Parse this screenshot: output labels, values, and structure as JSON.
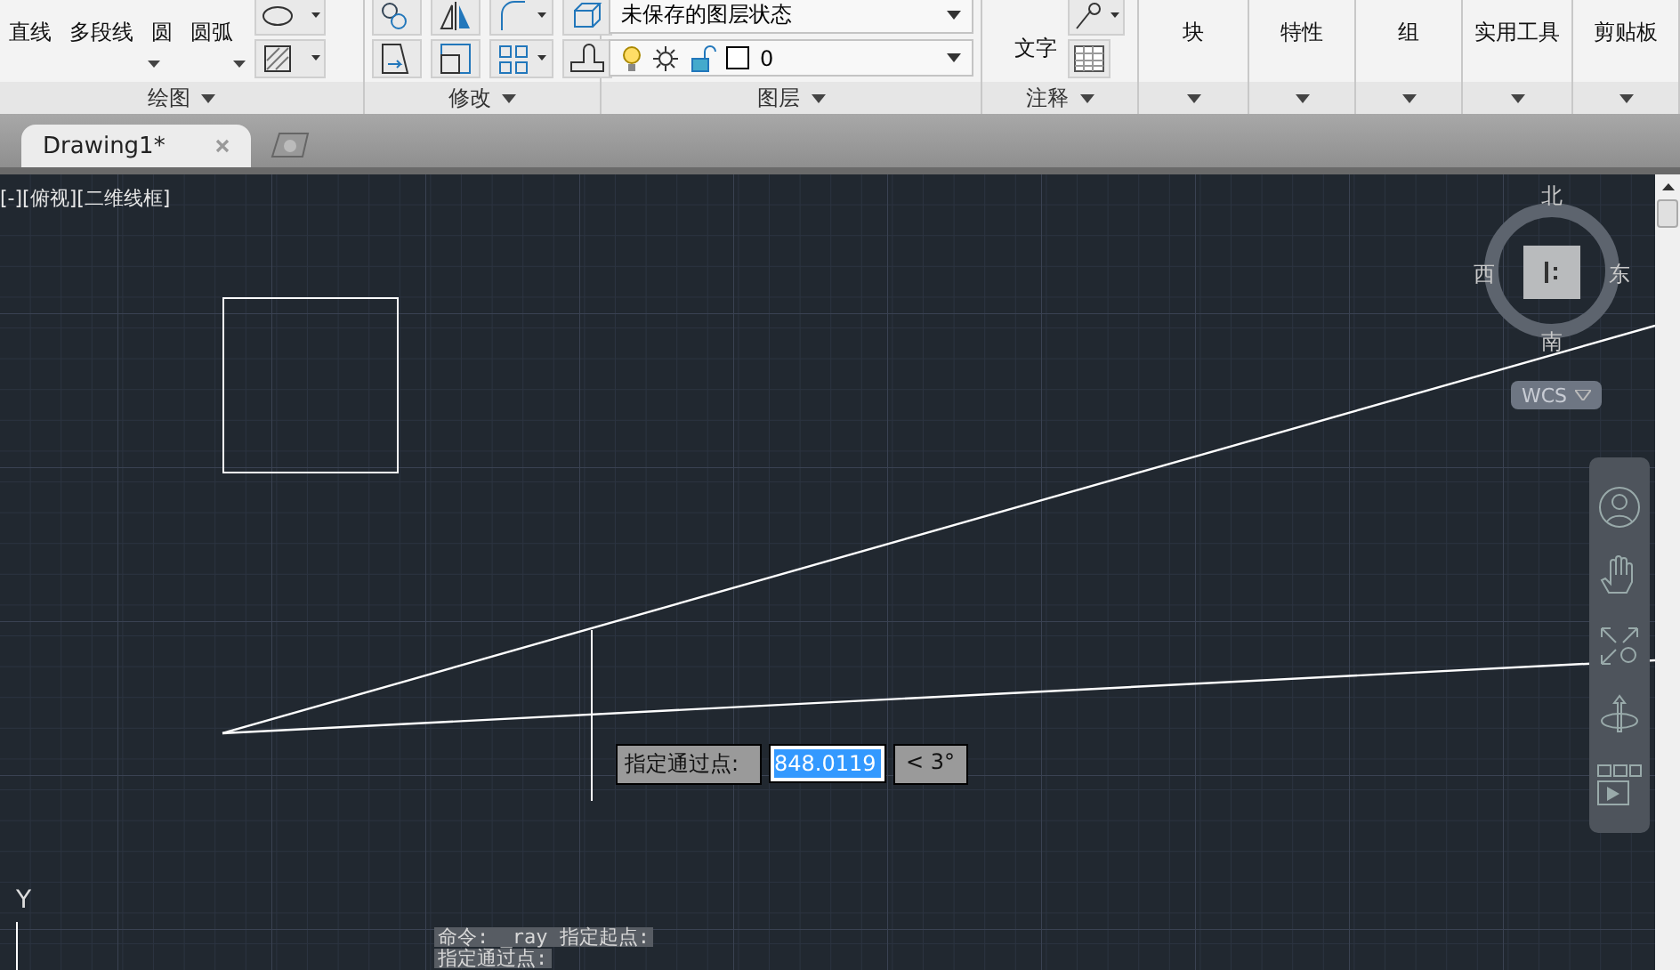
{
  "ribbon": {
    "panels": [
      {
        "kind": "draw",
        "title": "绘图",
        "buttons": [
          "直线",
          "多段线",
          "圆",
          "圆弧"
        ]
      },
      {
        "kind": "modify",
        "title": "修改"
      },
      {
        "kind": "layer",
        "title": "图层",
        "layer_state": "未保存的图层状态",
        "current_layer": "0"
      },
      {
        "kind": "annotate",
        "title": "注释",
        "buttons": [
          "文字"
        ]
      },
      {
        "kind": "collapsed",
        "title": "块"
      },
      {
        "kind": "collapsed",
        "title": "特性"
      },
      {
        "kind": "collapsed",
        "title": "组"
      },
      {
        "kind": "collapsed",
        "title": "实用工具"
      },
      {
        "kind": "collapsed",
        "title": "剪贴板"
      }
    ]
  },
  "tabs": [
    {
      "label": "Drawing1*",
      "selected": true
    }
  ],
  "viewport_label": "[-][俯视][二维线框]",
  "viewcube": {
    "north": "北",
    "south": "南",
    "east": "东",
    "west": "西",
    "ucs": "WCS"
  },
  "dynamic_input": {
    "prompt": "指定通过点:",
    "distance": "848.0119",
    "angle": "< 3°"
  },
  "axis_label": "Y",
  "command_history": [
    "命令: _ray 指定起点:",
    "指定通过点:"
  ]
}
